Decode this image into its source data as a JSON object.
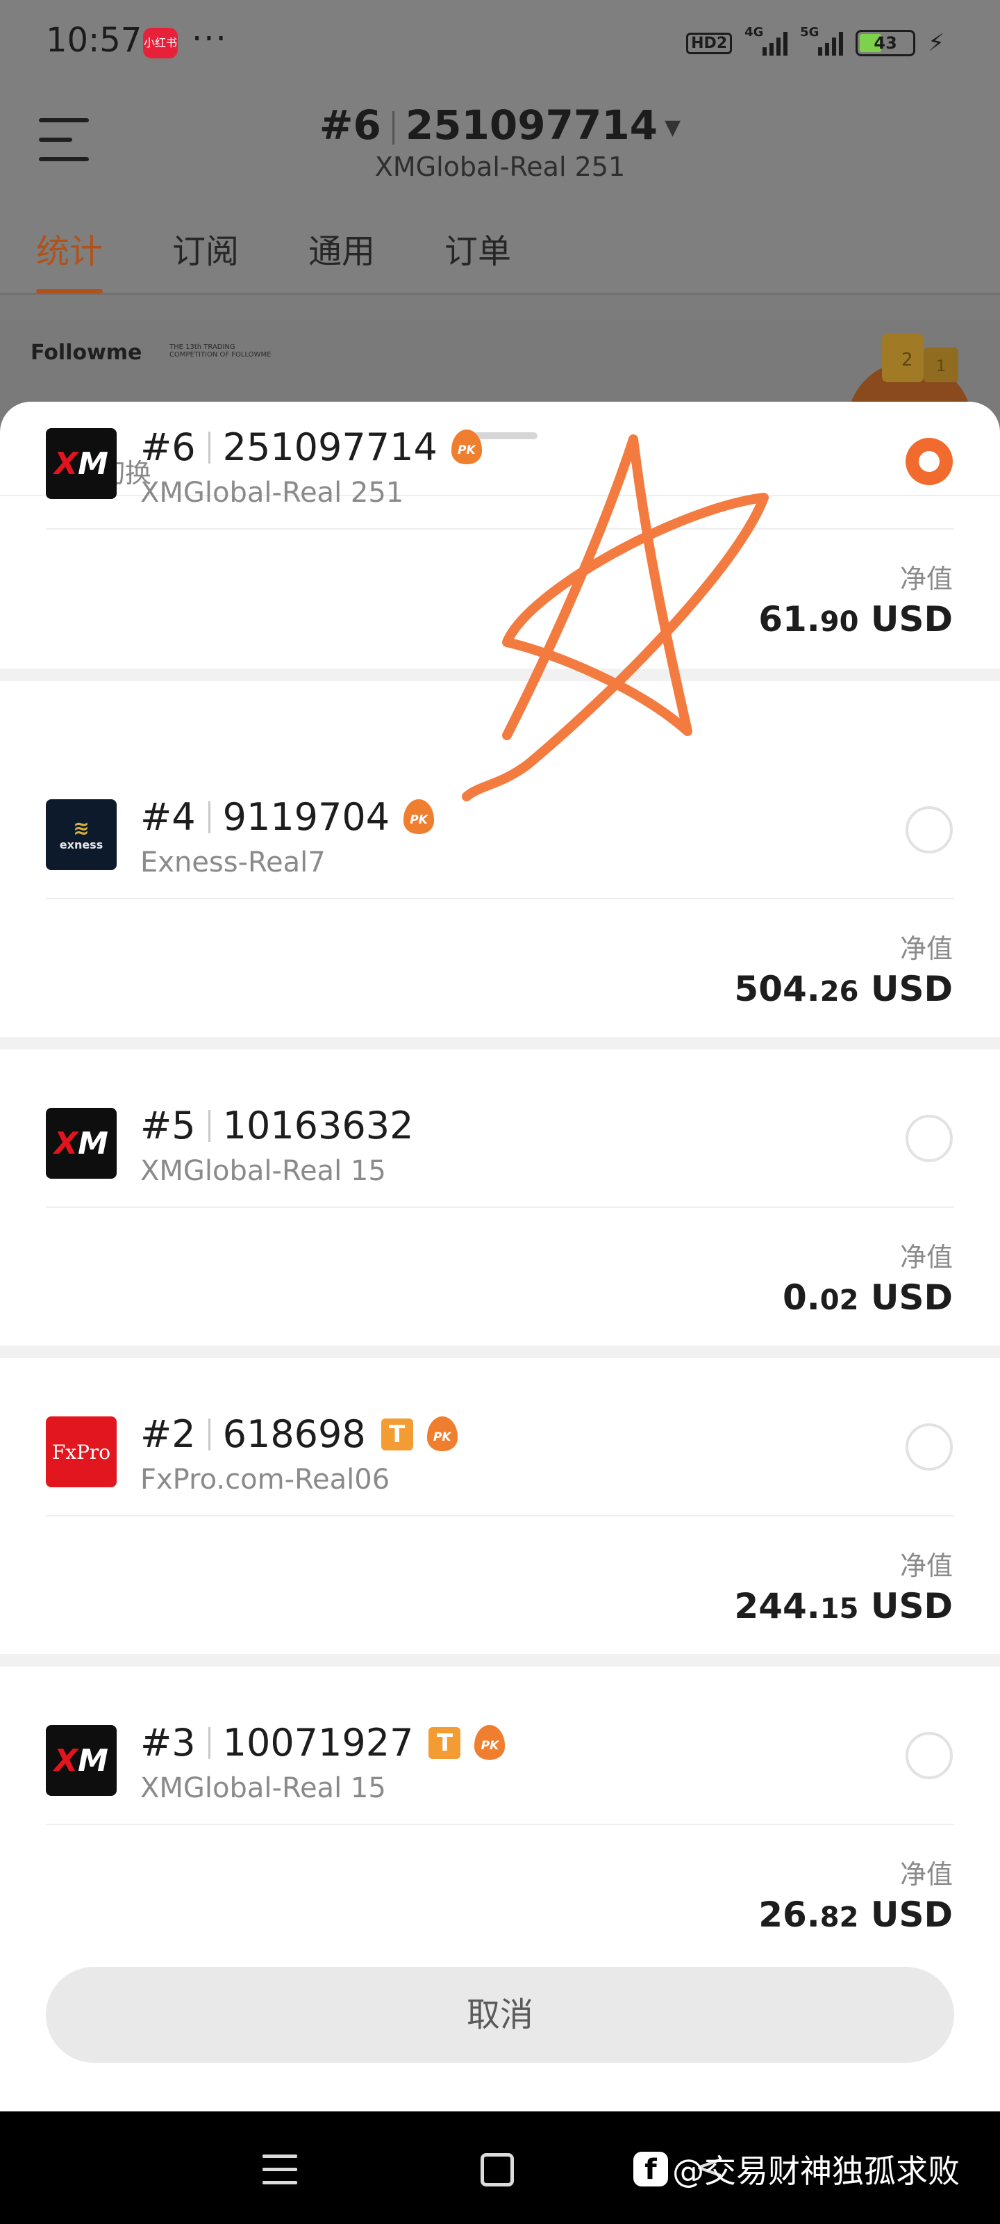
{
  "status_bar": {
    "time": "10:57",
    "app_icon_label": "小红书",
    "more": "···",
    "hd": "HD2",
    "net1": "4G",
    "net2": "5G",
    "battery": "43",
    "battery_level": 0.43
  },
  "header": {
    "account_num": "#6",
    "account_id": "251097714",
    "server": "XMGlobal-Real 251",
    "tabs": [
      "统计",
      "订阅",
      "通用",
      "订单"
    ],
    "active_tab": 0
  },
  "banner": {
    "brand": "Followme",
    "caption": "THE 13th TRADING COMPETITION OF FOLLOWME"
  },
  "sheet": {
    "title": "账户切换",
    "equity_label": "净值",
    "cancel_label": "取消",
    "accounts": [
      {
        "num": "#6",
        "id": "251097714",
        "server": "XMGlobal-Real 251",
        "broker": "XM",
        "t_badge": false,
        "pk": true,
        "selected": true,
        "equity_int": "61.",
        "equity_dec": "90",
        "currency": "USD"
      },
      {
        "num": "#4",
        "id": "9119704",
        "server": "Exness-Real7",
        "broker": "exness",
        "t_badge": false,
        "pk": true,
        "selected": false,
        "equity_int": "504.",
        "equity_dec": "26",
        "currency": "USD"
      },
      {
        "num": "#5",
        "id": "10163632",
        "server": "XMGlobal-Real 15",
        "broker": "XM",
        "t_badge": false,
        "pk": false,
        "selected": false,
        "equity_int": "0.",
        "equity_dec": "02",
        "currency": "USD"
      },
      {
        "num": "#2",
        "id": "618698",
        "server": "FxPro.com-Real06",
        "broker": "FxPro",
        "t_badge": true,
        "pk": true,
        "selected": false,
        "equity_int": "244.",
        "equity_dec": "15",
        "currency": "USD"
      },
      {
        "num": "#3",
        "id": "10071927",
        "server": "XMGlobal-Real 15",
        "broker": "XM",
        "t_badge": true,
        "pk": true,
        "selected": false,
        "equity_int": "26.",
        "equity_dec": "82",
        "currency": "USD"
      }
    ],
    "t_badge_text": "T",
    "pk_text": "PK"
  },
  "watermark": {
    "text": "@交易财神独孤求败"
  },
  "colors": {
    "accent": "#f26b2e",
    "star": "#f47b3f",
    "overlay": "#7f7f7f"
  }
}
